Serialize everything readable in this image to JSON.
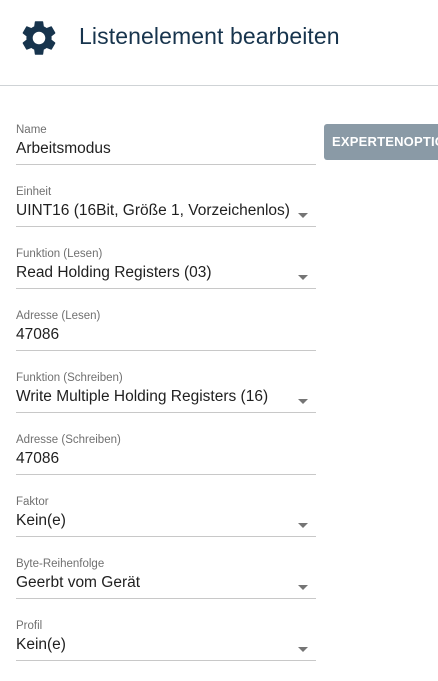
{
  "header": {
    "title": "Listenelement bearbeiten",
    "icon": "gear-icon",
    "icon_color": "#17344d"
  },
  "expert_button": {
    "label": "EXPERTENOPTIONEN",
    "color": "#8a9aa6"
  },
  "fields": [
    {
      "label": "Name",
      "value": "Arbeitsmodus",
      "type": "text"
    },
    {
      "label": "Einheit",
      "value": "UINT16 (16Bit, Größe 1, Vorzeichenlos)",
      "type": "select"
    },
    {
      "label": "Funktion (Lesen)",
      "value": "Read Holding Registers (03)",
      "type": "select"
    },
    {
      "label": "Adresse (Lesen)",
      "value": "47086",
      "type": "text"
    },
    {
      "label": "Funktion (Schreiben)",
      "value": "Write Multiple Holding Registers (16)",
      "type": "select"
    },
    {
      "label": "Adresse (Schreiben)",
      "value": "47086",
      "type": "text"
    },
    {
      "label": "Faktor",
      "value": "Kein(e)",
      "type": "select"
    },
    {
      "label": "Byte-Reihenfolge",
      "value": "Geerbt vom Gerät",
      "type": "select"
    },
    {
      "label": "Profil",
      "value": "Kein(e)",
      "type": "select"
    }
  ]
}
